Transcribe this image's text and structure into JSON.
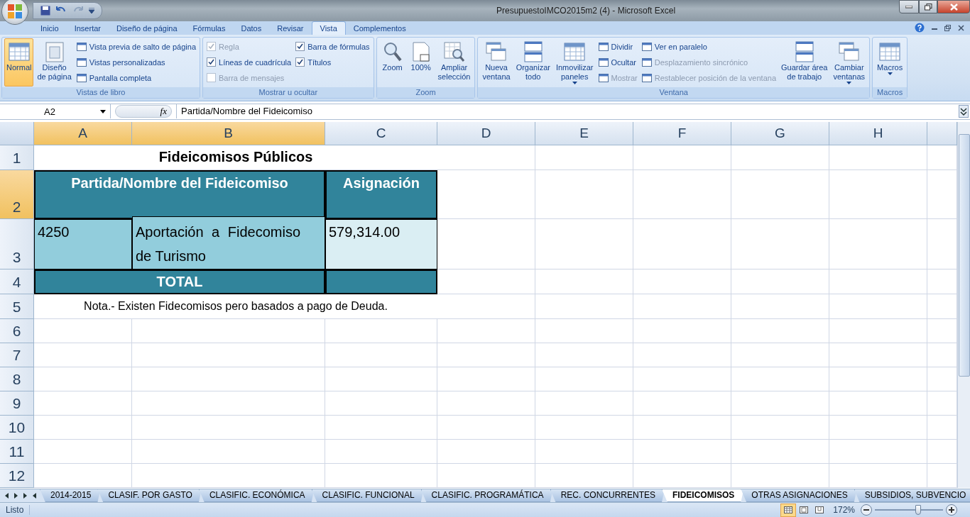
{
  "window": {
    "title": "PresupuestoIMCO2015m2 (4) - Microsoft Excel"
  },
  "ribbon_tabs": [
    {
      "label": "Inicio",
      "selected": false
    },
    {
      "label": "Insertar",
      "selected": false
    },
    {
      "label": "Diseño de página",
      "selected": false
    },
    {
      "label": "Fórmulas",
      "selected": false
    },
    {
      "label": "Datos",
      "selected": false
    },
    {
      "label": "Revisar",
      "selected": false
    },
    {
      "label": "Vista",
      "selected": true
    },
    {
      "label": "Complementos",
      "selected": false
    }
  ],
  "ribbon_groups": [
    {
      "title": "Vistas de libro",
      "items": [
        {
          "kind": "large",
          "lines": [
            "Normal"
          ],
          "selected": true
        },
        {
          "kind": "large",
          "lines": [
            "Diseño",
            "de página"
          ],
          "selected": false
        },
        {
          "kind": "small",
          "label": "Vista previa de salto de página",
          "disabled": false
        },
        {
          "kind": "small",
          "label": "Vistas personalizadas",
          "disabled": false
        },
        {
          "kind": "small",
          "label": "Pantalla completa",
          "disabled": false
        }
      ]
    },
    {
      "title": "Mostrar u ocultar",
      "items": [
        {
          "kind": "checkbox",
          "label": "Regla",
          "checked": true,
          "disabled": true
        },
        {
          "kind": "checkbox",
          "label": "Líneas de cuadrícula",
          "checked": true,
          "disabled": false
        },
        {
          "kind": "checkbox",
          "label": "Barra de mensajes",
          "checked": false,
          "disabled": true
        },
        {
          "kind": "checkbox",
          "label": "Barra de fórmulas",
          "checked": true,
          "disabled": false
        },
        {
          "kind": "checkbox",
          "label": "Títulos",
          "checked": true,
          "disabled": false
        }
      ]
    },
    {
      "title": "Zoom",
      "items": [
        {
          "kind": "large",
          "lines": [
            "Zoom"
          ],
          "selected": false
        },
        {
          "kind": "large",
          "lines": [
            "100%"
          ],
          "selected": false
        },
        {
          "kind": "large",
          "lines": [
            "Ampliar",
            "selección"
          ],
          "selected": false
        }
      ]
    },
    {
      "title": "Ventana",
      "items": [
        {
          "kind": "large",
          "lines": [
            "Nueva",
            "ventana"
          ],
          "selected": false
        },
        {
          "kind": "large",
          "lines": [
            "Organizar",
            "todo"
          ],
          "selected": false
        },
        {
          "kind": "large",
          "lines": [
            "Inmovilizar",
            "paneles"
          ],
          "selected": false,
          "dropdown": true
        },
        {
          "kind": "small",
          "label": "Dividir",
          "disabled": false
        },
        {
          "kind": "small",
          "label": "Ocultar",
          "disabled": false
        },
        {
          "kind": "small",
          "label": "Mostrar",
          "disabled": true
        },
        {
          "kind": "small",
          "label": "Ver en paralelo",
          "disabled": false
        },
        {
          "kind": "small",
          "label": "Desplazamiento sincrónico",
          "disabled": true
        },
        {
          "kind": "small",
          "label": "Restablecer posición de la ventana",
          "disabled": true
        },
        {
          "kind": "large",
          "lines": [
            "Guardar área",
            "de trabajo"
          ],
          "selected": false
        },
        {
          "kind": "large",
          "lines": [
            "Cambiar",
            "ventanas"
          ],
          "selected": false,
          "dropdown": true
        }
      ]
    },
    {
      "title": "Macros",
      "items": [
        {
          "kind": "large",
          "lines": [
            "Macros"
          ],
          "selected": false,
          "dropdown": true
        }
      ]
    }
  ],
  "formula_bar": {
    "name_box": "A2",
    "function_label": "fx",
    "value": "Partida/Nombre del Fideicomiso"
  },
  "columns": [
    {
      "label": "A",
      "selected": true
    },
    {
      "label": "B",
      "selected": true
    },
    {
      "label": "C",
      "selected": false
    },
    {
      "label": "D",
      "selected": false
    },
    {
      "label": "E",
      "selected": false
    },
    {
      "label": "F",
      "selected": false
    },
    {
      "label": "G",
      "selected": false
    },
    {
      "label": "H",
      "selected": false
    }
  ],
  "rows": [
    {
      "number": "1",
      "selected": false,
      "cells": [
        "Fideicomisos Públicos"
      ]
    },
    {
      "number": "2",
      "selected": true,
      "cells": [
        "Partida/Nombre del Fideicomiso",
        "Asignación"
      ]
    },
    {
      "number": "3",
      "selected": false,
      "cells": [
        "4250",
        "Aportación a Fidecomiso de Turismo",
        "579,314.00"
      ]
    },
    {
      "number": "4",
      "selected": false,
      "cells": [
        "TOTAL"
      ]
    },
    {
      "number": "5",
      "selected": false,
      "cells": [
        "Nota.- Existen Fidecomisos pero basados a pago de Deuda."
      ]
    },
    {
      "number": "6",
      "selected": false,
      "cells": []
    },
    {
      "number": "7",
      "selected": false,
      "cells": []
    },
    {
      "number": "8",
      "selected": false,
      "cells": []
    },
    {
      "number": "9",
      "selected": false,
      "cells": []
    },
    {
      "number": "10",
      "selected": false,
      "cells": []
    },
    {
      "number": "11",
      "selected": false,
      "cells": []
    },
    {
      "number": "12",
      "selected": false,
      "cells": []
    }
  ],
  "sheet_tabs": [
    {
      "label": "2014-2015",
      "selected": false
    },
    {
      "label": "CLASIF. POR GASTO",
      "selected": false
    },
    {
      "label": "CLASIFIC. ECONÓMICA",
      "selected": false
    },
    {
      "label": "CLASIFIC. FUNCIONAL",
      "selected": false
    },
    {
      "label": "CLASIFIC. PROGRAMÁTICA",
      "selected": false
    },
    {
      "label": "REC. CONCURRENTES",
      "selected": false
    },
    {
      "label": "FIDEICOMISOS",
      "selected": true
    },
    {
      "label": "OTRAS ASIGNACIONES",
      "selected": false
    },
    {
      "label": "SUBSIDIOS, SUBVENCIO",
      "selected": false
    }
  ],
  "status_bar": {
    "status": "Listo",
    "view_modes": [
      {
        "selected": true
      },
      {
        "selected": false
      },
      {
        "selected": false
      }
    ],
    "zoom": "172%",
    "zoom_slider": {
      "level": 0.64
    }
  }
}
